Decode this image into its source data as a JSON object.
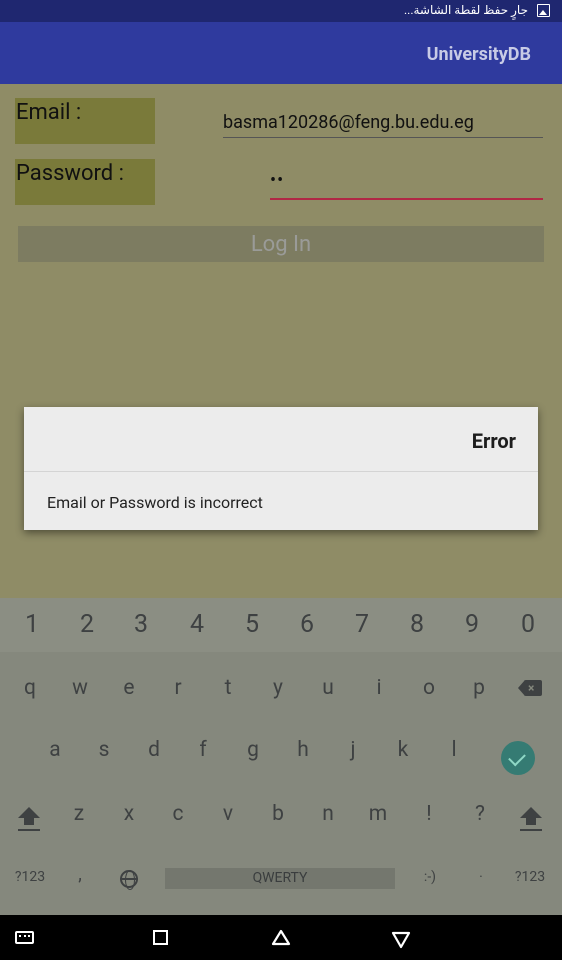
{
  "status_bar": {
    "notification_text": "جارٍ حفظ لقطة الشاشة...",
    "icon": "image-icon"
  },
  "app_bar": {
    "title": "UniversityDB"
  },
  "form": {
    "email_label": "Email :",
    "email_value": "basma120286@feng.bu.edu.eg",
    "password_label": "Password :",
    "password_value": "••",
    "login_button": "Log In"
  },
  "dialog": {
    "title": "Error",
    "message": "Email or Password is incorrect"
  },
  "keyboard": {
    "number_row": [
      "1",
      "2",
      "3",
      "4",
      "5",
      "6",
      "7",
      "8",
      "9",
      "0"
    ],
    "row1": [
      "q",
      "w",
      "e",
      "r",
      "t",
      "y",
      "u",
      "i",
      "o",
      "p"
    ],
    "row2": [
      "a",
      "s",
      "d",
      "f",
      "g",
      "h",
      "j",
      "k",
      "l"
    ],
    "row3": [
      "z",
      "x",
      "c",
      "v",
      "b",
      "n",
      "m",
      "!",
      "?"
    ],
    "symbols_key": "?123",
    "comma_key": ",",
    "space_label": "QWERTY",
    "emoticon_key": ":-)",
    "period_key": "·",
    "symbols_key_right": "?123"
  },
  "nav_bar": {
    "icons": [
      "keyboard-switch-icon",
      "recents-icon",
      "home-icon",
      "back-icon"
    ]
  },
  "colors": {
    "status_bar": "#1f2770",
    "app_bar": "#2f3a9e",
    "password_underline": "#b02845",
    "enter_key": "#357b73"
  }
}
